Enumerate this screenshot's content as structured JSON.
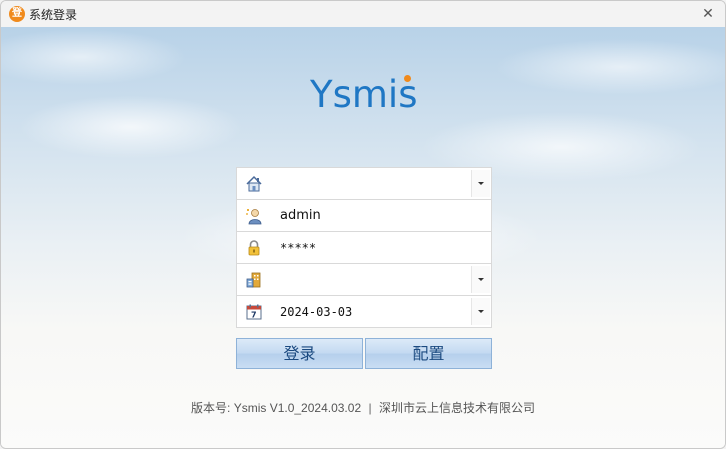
{
  "window": {
    "title": "系统登录",
    "app_icon_glyph": "登",
    "close_glyph": "✕"
  },
  "logo": {
    "text": "Ysmis",
    "accent_color": "#f08a1c",
    "color": "#1f77c4"
  },
  "form": {
    "account_set": {
      "value": "",
      "icon": "home-icon"
    },
    "username": {
      "value": "admin",
      "icon": "user-icon"
    },
    "password": {
      "value": "*****",
      "icon": "lock-icon"
    },
    "organization": {
      "value": "",
      "icon": "building-icon"
    },
    "date": {
      "value": "2024-03-03",
      "icon": "calendar-icon"
    }
  },
  "buttons": {
    "login": "登录",
    "config": "配置"
  },
  "footer": {
    "version": "版本号: Ysmis  V1.0_2024.03.02",
    "separator": "|",
    "company": "深圳市云上信息技术有限公司"
  }
}
